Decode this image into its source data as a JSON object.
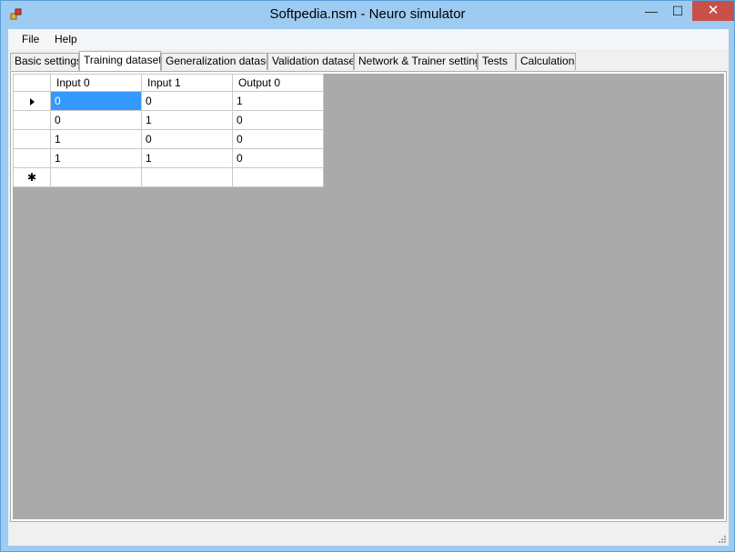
{
  "window": {
    "title": "Softpedia.nsm - Neuro simulator",
    "minimize_glyph": "—",
    "maximize_glyph": "☐",
    "close_glyph": "✕"
  },
  "menu": {
    "items": [
      "File",
      "Help"
    ]
  },
  "tabs": {
    "items": [
      "Basic settings",
      "Training dataset",
      "Generalization dataset",
      "Validation dataset",
      "Network & Trainer settings",
      "Tests",
      "Calculations"
    ],
    "active_index": 1
  },
  "grid": {
    "columns": [
      "Input 0",
      "Input 1",
      "Output 0"
    ],
    "rows": [
      [
        "0",
        "0",
        "1"
      ],
      [
        "0",
        "1",
        "0"
      ],
      [
        "1",
        "0",
        "0"
      ],
      [
        "1",
        "1",
        "0"
      ]
    ],
    "new_row_glyph": "✱",
    "selected_cell": "0,0"
  },
  "colors": {
    "titlebar": "#9ecbf2",
    "close_button": "#c7504a",
    "selection": "#3399ff",
    "grid_background": "#aaaaaa"
  }
}
